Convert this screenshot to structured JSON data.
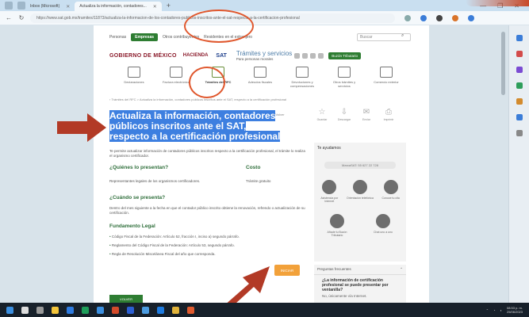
{
  "browser": {
    "tabs": [
      {
        "label": "Inbox (Microsoft)",
        "active": false
      },
      {
        "label": "Actualiza la información, contadores...",
        "active": true
      }
    ],
    "new_tab": "+",
    "url": "https://www.sat.gob.mx/tramites/11873/actualiza-la-informacion-de-los-contadores-publicos-inscritos-ante-el-sat-respecto-a-la-certificacion-profesional",
    "window_controls": [
      "—",
      "❐",
      "✕"
    ]
  },
  "site": {
    "nav": {
      "personas": "Personas",
      "empresas": "Empresas",
      "otros": "Otros contribuyentes",
      "residentes": "Residentes en el extranjero"
    },
    "search_placeholder": "Buscar",
    "logos": {
      "mexico": "GOBIERNO DE MÉXICO",
      "hacienda": "HACIENDA",
      "sat": "SAT"
    },
    "tramites_title": "Trámites y servicios",
    "tramites_sub": "Para personas morales",
    "buzon": "Buzón Tributario",
    "categories": [
      {
        "label": "Declaraciones",
        "highlight": false
      },
      {
        "label": "Factura electrónica",
        "highlight": false
      },
      {
        "label": "Trámites del RFC",
        "highlight": true
      },
      {
        "label": "Adeudos fiscales",
        "highlight": false
      },
      {
        "label": "Devoluciones y compensaciones",
        "highlight": false
      },
      {
        "label": "Otros trámites y servicios",
        "highlight": false
      },
      {
        "label": "Comercio exterior",
        "highlight": false
      }
    ],
    "breadcrumb": "‹ Trámites del RFC > Actualiza la información, contadores públicos inscritos ante el SAT, respecto a la certificación profesional"
  },
  "content": {
    "title": "Actualiza la información, contadores públicos inscritos ante el SAT, respecto a la certificación profesional",
    "editar": "< Volver",
    "actions": [
      {
        "icon": "star-icon",
        "label": "Guardar"
      },
      {
        "icon": "download-icon",
        "label": "Descargar"
      },
      {
        "icon": "share-icon",
        "label": "Enviar"
      },
      {
        "icon": "print-icon",
        "label": "Imprimir"
      }
    ],
    "description": "Te permite actualizar información de contadores públicos inscritos respecto a la certificación profesional, el trámite lo realiza el organismo certificador.",
    "quienes_h": "¿Quiénes lo presentan?",
    "quienes_v": "Representantes legales de los organismos certificadores.",
    "costo_h": "Costo",
    "costo_v": "Trámite gratuito",
    "cuando_h": "¿Cuándo se presenta?",
    "cuando_v": "Dentro del mes siguiente a la fecha en que el contador público inscrito obtiene la renovación, refrendo o actualización de su certificación.",
    "fund_h": "Fundamento Legal",
    "fund": [
      "Código Fiscal de la Federación: Artículo 52, fracción I, inciso a) segundo párrafo.",
      "Reglamento del Código Fiscal de la Federación: Artículo 53, segundo párrafo.",
      "Regla de Resolución Miscelánea Fiscal del año que corresponda."
    ],
    "iniciar": "INICIAR",
    "green_btn": "VOLVER"
  },
  "help": {
    "title": "Te ayudamos",
    "marcasat": "MarcaSAT: 55 627 22 728",
    "items": [
      {
        "label": "Asistencia por Internet"
      },
      {
        "label": "Orientación telefónica"
      },
      {
        "label": "Conoce tu cita"
      },
      {
        "label": "Añade tu Buzón Tributario"
      },
      {
        "label": "Chat uno a uno"
      }
    ]
  },
  "faq": {
    "title": "Preguntas frecuentes",
    "question": "¿La información de certificación profesional se puede presentar por ventanilla?",
    "answer": "No, únicamente vía Internet."
  },
  "taskbar": {
    "time": "08:53 p. m.",
    "date": "25/06/2023"
  }
}
